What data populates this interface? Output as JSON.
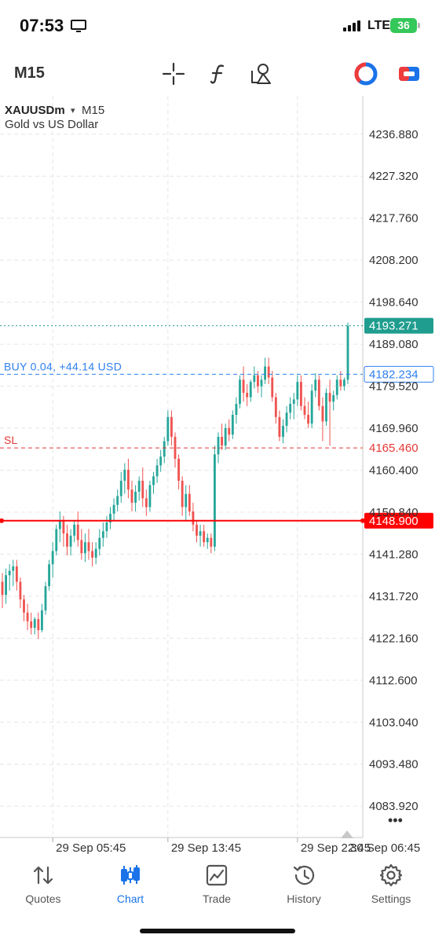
{
  "status_bar": {
    "time": "07:53",
    "network": "LTE",
    "battery": "36"
  },
  "toolbar": {
    "timeframe": "M15",
    "icons": [
      "crosshair-icon",
      "indicator-icon",
      "objects-icon",
      "trade-cycle-icon",
      "account-switch-icon"
    ]
  },
  "chart_data": {
    "type": "candlestick",
    "symbol": "XAUUSDm",
    "symbol_dropdown": "▾",
    "timeframe": "M15",
    "description": "Gold vs US Dollar",
    "price_scale": [
      "4236.880",
      "4227.320",
      "4217.760",
      "4208.200",
      "4198.640",
      "4189.080",
      "4179.520",
      "4169.960",
      "4160.400",
      "4150.840",
      "4141.280",
      "4131.720",
      "4122.160",
      "4112.600",
      "4103.040",
      "4093.480",
      "4083.920"
    ],
    "ylim": [
      4076.8,
      4245.6
    ],
    "time_labels": [
      "29 Sep 05:45",
      "29 Sep 13:45",
      "29 Sep 22:45",
      "30 Sep 06:45"
    ],
    "grid": true,
    "colors": {
      "bull": "#26a69a",
      "bear": "#ef5350",
      "position": "#2f80ed",
      "stop_loss": "#e53935",
      "alert": "#ff0000",
      "bid": "#1f9d8f"
    },
    "current_price": {
      "label": "4193.271",
      "value": 4193.271
    },
    "position": {
      "label": "BUY 0.04, +44.14 USD",
      "price_label": "4182.234",
      "value": 4182.234
    },
    "stop_loss": {
      "label": "SL",
      "price_label": "4165.460",
      "value": 4165.46
    },
    "alert_line": {
      "price_label": "4148.900",
      "value": 4148.9
    },
    "more_label": "•••",
    "candles": [
      [
        4135.0,
        4137.0,
        4129.0,
        4132.0
      ],
      [
        4132.0,
        4138.0,
        4130.0,
        4136.5
      ],
      [
        4136.5,
        4139.0,
        4133.0,
        4137.5
      ],
      [
        4137.5,
        4140.0,
        4134.0,
        4138.5
      ],
      [
        4138.5,
        4140.0,
        4133.0,
        4135.0
      ],
      [
        4135.0,
        4136.0,
        4129.0,
        4131.0
      ],
      [
        4131.0,
        4132.0,
        4126.0,
        4128.0
      ],
      [
        4128.0,
        4130.0,
        4124.0,
        4126.0
      ],
      [
        4126.0,
        4128.0,
        4123.0,
        4124.5
      ],
      [
        4124.5,
        4127.0,
        4123.0,
        4126.5
      ],
      [
        4126.5,
        4128.0,
        4122.0,
        4124.0
      ],
      [
        4124.0,
        4130.0,
        4123.5,
        4128.5
      ],
      [
        4128.5,
        4135.0,
        4127.5,
        4134.0
      ],
      [
        4134.0,
        4140.0,
        4133.0,
        4139.0
      ],
      [
        4139.0,
        4144.0,
        4136.0,
        4142.0
      ],
      [
        4142.0,
        4148.0,
        4141.0,
        4147.0
      ],
      [
        4147.0,
        4151.0,
        4144.0,
        4149.0
      ],
      [
        4149.0,
        4150.0,
        4143.0,
        4146.0
      ],
      [
        4146.0,
        4148.0,
        4141.0,
        4143.0
      ],
      [
        4143.0,
        4147.0,
        4141.0,
        4145.5
      ],
      [
        4145.5,
        4149.0,
        4144.0,
        4148.0
      ],
      [
        4148.0,
        4151.0,
        4143.0,
        4144.5
      ],
      [
        4144.5,
        4147.0,
        4140.0,
        4141.5
      ],
      [
        4141.5,
        4146.0,
        4139.5,
        4144.0
      ],
      [
        4144.0,
        4147.0,
        4140.0,
        4142.0
      ],
      [
        4142.0,
        4144.0,
        4138.5,
        4140.5
      ],
      [
        4140.5,
        4144.0,
        4139.0,
        4142.5
      ],
      [
        4142.5,
        4147.0,
        4141.0,
        4145.0
      ],
      [
        4145.0,
        4148.5,
        4143.0,
        4146.5
      ],
      [
        4146.5,
        4150.0,
        4145.0,
        4148.5
      ],
      [
        4148.5,
        4152.0,
        4147.0,
        4150.5
      ],
      [
        4150.5,
        4154.0,
        4149.0,
        4152.5
      ],
      [
        4152.5,
        4156.0,
        4151.0,
        4154.5
      ],
      [
        4154.5,
        4160.0,
        4153.0,
        4158.0
      ],
      [
        4158.0,
        4162.0,
        4155.0,
        4160.5
      ],
      [
        4160.5,
        4163.0,
        4154.0,
        4156.0
      ],
      [
        4156.0,
        4158.0,
        4151.0,
        4153.0
      ],
      [
        4153.0,
        4157.0,
        4151.0,
        4155.5
      ],
      [
        4155.5,
        4159.0,
        4153.5,
        4158.0
      ],
      [
        4158.0,
        4161.0,
        4152.0,
        4154.0
      ],
      [
        4154.0,
        4156.0,
        4150.0,
        4152.0
      ],
      [
        4152.0,
        4158.0,
        4151.0,
        4157.0
      ],
      [
        4157.0,
        4160.0,
        4155.0,
        4159.0
      ],
      [
        4159.0,
        4163.0,
        4157.5,
        4161.5
      ],
      [
        4161.5,
        4165.0,
        4160.0,
        4163.5
      ],
      [
        4163.5,
        4168.0,
        4162.0,
        4167.0
      ],
      [
        4167.0,
        4174.0,
        4166.0,
        4172.5
      ],
      [
        4172.5,
        4174.0,
        4166.0,
        4168.0
      ],
      [
        4168.0,
        4169.0,
        4161.0,
        4163.0
      ],
      [
        4163.0,
        4164.0,
        4156.0,
        4158.0
      ],
      [
        4158.0,
        4159.0,
        4150.0,
        4152.0
      ],
      [
        4152.0,
        4157.0,
        4149.0,
        4155.0
      ],
      [
        4155.0,
        4157.0,
        4150.0,
        4151.0
      ],
      [
        4151.0,
        4153.0,
        4146.5,
        4148.0
      ],
      [
        4148.0,
        4149.0,
        4144.0,
        4145.5
      ],
      [
        4145.5,
        4148.0,
        4143.0,
        4146.5
      ],
      [
        4146.5,
        4148.0,
        4143.0,
        4144.0
      ],
      [
        4144.0,
        4146.0,
        4142.5,
        4145.0
      ],
      [
        4145.0,
        4146.0,
        4141.5,
        4143.0
      ],
      [
        4143.0,
        4166.0,
        4142.0,
        4164.0
      ],
      [
        4164.0,
        4169.0,
        4162.0,
        4168.0
      ],
      [
        4168.0,
        4171.0,
        4165.0,
        4166.0
      ],
      [
        4166.0,
        4171.0,
        4165.0,
        4170.0
      ],
      [
        4170.0,
        4172.0,
        4167.0,
        4168.5
      ],
      [
        4168.5,
        4174.0,
        4167.5,
        4173.0
      ],
      [
        4173.0,
        4177.0,
        4171.0,
        4175.5
      ],
      [
        4175.5,
        4182.0,
        4174.5,
        4181.0
      ],
      [
        4181.0,
        4184.0,
        4176.0,
        4178.0
      ],
      [
        4178.0,
        4180.0,
        4175.0,
        4177.0
      ],
      [
        4177.0,
        4181.0,
        4176.0,
        4180.5
      ],
      [
        4180.5,
        4184.0,
        4179.0,
        4182.0
      ],
      [
        4182.0,
        4183.0,
        4178.0,
        4179.5
      ],
      [
        4179.5,
        4182.0,
        4177.0,
        4181.0
      ],
      [
        4181.0,
        4186.0,
        4180.0,
        4184.0
      ],
      [
        4184.0,
        4186.0,
        4180.0,
        4181.5
      ],
      [
        4181.5,
        4183.0,
        4176.0,
        4177.0
      ],
      [
        4177.0,
        4178.0,
        4171.0,
        4172.5
      ],
      [
        4172.5,
        4174.0,
        4167.0,
        4168.0
      ],
      [
        4168.0,
        4172.0,
        4166.5,
        4170.5
      ],
      [
        4170.5,
        4175.0,
        4169.0,
        4173.5
      ],
      [
        4173.5,
        4177.0,
        4172.0,
        4175.5
      ],
      [
        4175.5,
        4178.0,
        4172.0,
        4176.5
      ],
      [
        4176.5,
        4182.0,
        4175.0,
        4180.5
      ],
      [
        4180.5,
        4182.0,
        4174.0,
        4175.0
      ],
      [
        4175.0,
        4177.0,
        4172.0,
        4173.0
      ],
      [
        4173.0,
        4176.0,
        4170.0,
        4171.0
      ],
      [
        4171.0,
        4180.0,
        4170.0,
        4178.5
      ],
      [
        4178.5,
        4182.5,
        4177.0,
        4181.0
      ],
      [
        4181.0,
        4182.0,
        4174.0,
        4175.0
      ],
      [
        4175.0,
        4177.0,
        4167.0,
        4171.5
      ],
      [
        4171.5,
        4179.0,
        4170.5,
        4178.0
      ],
      [
        4178.0,
        4181.0,
        4166.0,
        4176.0
      ],
      [
        4176.0,
        4178.5,
        4174.0,
        4177.5
      ],
      [
        4177.5,
        4182.0,
        4176.5,
        4181.0
      ],
      [
        4181.0,
        4183.0,
        4178.5,
        4179.5
      ],
      [
        4179.5,
        4181.5,
        4178.5,
        4181.0
      ],
      [
        4181.0,
        4194.0,
        4180.0,
        4193.271
      ]
    ]
  },
  "tabbar": {
    "tabs": [
      {
        "label": "Quotes"
      },
      {
        "label": "Chart"
      },
      {
        "label": "Trade"
      },
      {
        "label": "History"
      },
      {
        "label": "Settings"
      }
    ]
  }
}
